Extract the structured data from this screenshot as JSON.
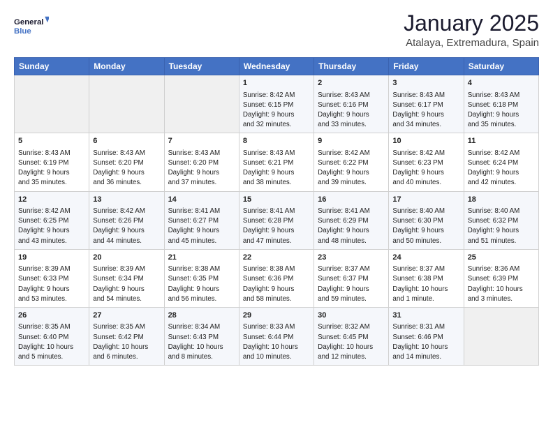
{
  "header": {
    "logo_line1": "General",
    "logo_line2": "Blue",
    "month": "January 2025",
    "location": "Atalaya, Extremadura, Spain"
  },
  "weekdays": [
    "Sunday",
    "Monday",
    "Tuesday",
    "Wednesday",
    "Thursday",
    "Friday",
    "Saturday"
  ],
  "weeks": [
    [
      {
        "day": "",
        "info": ""
      },
      {
        "day": "",
        "info": ""
      },
      {
        "day": "",
        "info": ""
      },
      {
        "day": "1",
        "info": "Sunrise: 8:42 AM\nSunset: 6:15 PM\nDaylight: 9 hours\nand 32 minutes."
      },
      {
        "day": "2",
        "info": "Sunrise: 8:43 AM\nSunset: 6:16 PM\nDaylight: 9 hours\nand 33 minutes."
      },
      {
        "day": "3",
        "info": "Sunrise: 8:43 AM\nSunset: 6:17 PM\nDaylight: 9 hours\nand 34 minutes."
      },
      {
        "day": "4",
        "info": "Sunrise: 8:43 AM\nSunset: 6:18 PM\nDaylight: 9 hours\nand 35 minutes."
      }
    ],
    [
      {
        "day": "5",
        "info": "Sunrise: 8:43 AM\nSunset: 6:19 PM\nDaylight: 9 hours\nand 35 minutes."
      },
      {
        "day": "6",
        "info": "Sunrise: 8:43 AM\nSunset: 6:20 PM\nDaylight: 9 hours\nand 36 minutes."
      },
      {
        "day": "7",
        "info": "Sunrise: 8:43 AM\nSunset: 6:20 PM\nDaylight: 9 hours\nand 37 minutes."
      },
      {
        "day": "8",
        "info": "Sunrise: 8:43 AM\nSunset: 6:21 PM\nDaylight: 9 hours\nand 38 minutes."
      },
      {
        "day": "9",
        "info": "Sunrise: 8:42 AM\nSunset: 6:22 PM\nDaylight: 9 hours\nand 39 minutes."
      },
      {
        "day": "10",
        "info": "Sunrise: 8:42 AM\nSunset: 6:23 PM\nDaylight: 9 hours\nand 40 minutes."
      },
      {
        "day": "11",
        "info": "Sunrise: 8:42 AM\nSunset: 6:24 PM\nDaylight: 9 hours\nand 42 minutes."
      }
    ],
    [
      {
        "day": "12",
        "info": "Sunrise: 8:42 AM\nSunset: 6:25 PM\nDaylight: 9 hours\nand 43 minutes."
      },
      {
        "day": "13",
        "info": "Sunrise: 8:42 AM\nSunset: 6:26 PM\nDaylight: 9 hours\nand 44 minutes."
      },
      {
        "day": "14",
        "info": "Sunrise: 8:41 AM\nSunset: 6:27 PM\nDaylight: 9 hours\nand 45 minutes."
      },
      {
        "day": "15",
        "info": "Sunrise: 8:41 AM\nSunset: 6:28 PM\nDaylight: 9 hours\nand 47 minutes."
      },
      {
        "day": "16",
        "info": "Sunrise: 8:41 AM\nSunset: 6:29 PM\nDaylight: 9 hours\nand 48 minutes."
      },
      {
        "day": "17",
        "info": "Sunrise: 8:40 AM\nSunset: 6:30 PM\nDaylight: 9 hours\nand 50 minutes."
      },
      {
        "day": "18",
        "info": "Sunrise: 8:40 AM\nSunset: 6:32 PM\nDaylight: 9 hours\nand 51 minutes."
      }
    ],
    [
      {
        "day": "19",
        "info": "Sunrise: 8:39 AM\nSunset: 6:33 PM\nDaylight: 9 hours\nand 53 minutes."
      },
      {
        "day": "20",
        "info": "Sunrise: 8:39 AM\nSunset: 6:34 PM\nDaylight: 9 hours\nand 54 minutes."
      },
      {
        "day": "21",
        "info": "Sunrise: 8:38 AM\nSunset: 6:35 PM\nDaylight: 9 hours\nand 56 minutes."
      },
      {
        "day": "22",
        "info": "Sunrise: 8:38 AM\nSunset: 6:36 PM\nDaylight: 9 hours\nand 58 minutes."
      },
      {
        "day": "23",
        "info": "Sunrise: 8:37 AM\nSunset: 6:37 PM\nDaylight: 9 hours\nand 59 minutes."
      },
      {
        "day": "24",
        "info": "Sunrise: 8:37 AM\nSunset: 6:38 PM\nDaylight: 10 hours\nand 1 minute."
      },
      {
        "day": "25",
        "info": "Sunrise: 8:36 AM\nSunset: 6:39 PM\nDaylight: 10 hours\nand 3 minutes."
      }
    ],
    [
      {
        "day": "26",
        "info": "Sunrise: 8:35 AM\nSunset: 6:40 PM\nDaylight: 10 hours\nand 5 minutes."
      },
      {
        "day": "27",
        "info": "Sunrise: 8:35 AM\nSunset: 6:42 PM\nDaylight: 10 hours\nand 6 minutes."
      },
      {
        "day": "28",
        "info": "Sunrise: 8:34 AM\nSunset: 6:43 PM\nDaylight: 10 hours\nand 8 minutes."
      },
      {
        "day": "29",
        "info": "Sunrise: 8:33 AM\nSunset: 6:44 PM\nDaylight: 10 hours\nand 10 minutes."
      },
      {
        "day": "30",
        "info": "Sunrise: 8:32 AM\nSunset: 6:45 PM\nDaylight: 10 hours\nand 12 minutes."
      },
      {
        "day": "31",
        "info": "Sunrise: 8:31 AM\nSunset: 6:46 PM\nDaylight: 10 hours\nand 14 minutes."
      },
      {
        "day": "",
        "info": ""
      }
    ]
  ]
}
